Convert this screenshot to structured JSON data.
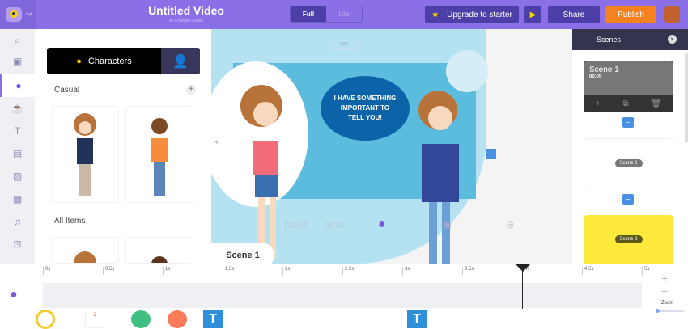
{
  "header": {
    "title": "Untitled Video",
    "subtitle": "All Changes Saved",
    "mode_full": "Full",
    "mode_lite": "Lite",
    "upgrade": "Upgrade to starter",
    "share": "Share",
    "publish": "Publish"
  },
  "rail": [
    "search-icon",
    "props-icon",
    "characters-icon",
    "coffee-icon",
    "text-icon",
    "backgrounds-icon",
    "images-icon",
    "video-icon",
    "music-icon",
    "upload-icon"
  ],
  "panel": {
    "tab_characters": "Characters",
    "section_casual": "Casual",
    "section_all": "All Items"
  },
  "canvas": {
    "zoom": "60%",
    "speech": "I HAVE SOMETHING IMPORTANT TO TELL YOU!",
    "scene_name": "Scene 1",
    "scene_duration": "[00:04]",
    "total": "00:28"
  },
  "scenes": {
    "title": "Scenes",
    "items": [
      {
        "name": "Scene 1",
        "duration": "00:05"
      },
      {
        "name": "Scene 2"
      },
      {
        "name": "Scene 3"
      }
    ]
  },
  "timeline": {
    "ticks": [
      "0s",
      "0.5s",
      "1s",
      "1.5s",
      "2s",
      "2.5s",
      "3s",
      "3.5s",
      "4s",
      "4.5s",
      "5s"
    ],
    "playhead_seconds": 4,
    "zoom_label": "Zoom"
  },
  "colors": {
    "header": "#8a6fe6",
    "accent": "#4d3fa8",
    "publish": "#f5821f",
    "scene3": "#fde93b"
  }
}
